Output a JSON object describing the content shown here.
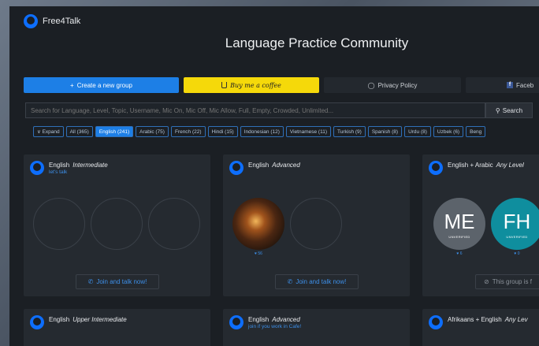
{
  "header": {
    "logo_text": "Free4Talk",
    "title": "Language Practice Community"
  },
  "topbar": {
    "create_label": "Create a new group",
    "coffee_label": "Buy me a coffee",
    "privacy_label": "Privacy Policy",
    "facebook_label": "Faceb"
  },
  "search": {
    "placeholder": "Search for Language, Level, Topic, Username, Mic On, Mic Off, Mic Allow, Full, Empty, Crowded, Unlimited...",
    "button_label": "Search"
  },
  "filters": [
    {
      "label": "∨ Expand"
    },
    {
      "label": "All (365)"
    },
    {
      "label": "English (241)",
      "active": true
    },
    {
      "label": "Arabic (75)"
    },
    {
      "label": "French (22)"
    },
    {
      "label": "Hindi (15)"
    },
    {
      "label": "Indonesian (12)"
    },
    {
      "label": "Vietnamese (11)"
    },
    {
      "label": "Turkish (9)"
    },
    {
      "label": "Spanish (8)"
    },
    {
      "label": "Urdu (8)"
    },
    {
      "label": "Uzbek (6)"
    },
    {
      "label": "Beng"
    }
  ],
  "cards": [
    {
      "language": "English",
      "level": "Intermediate",
      "topic": "let's talk",
      "join_label": "Join and talk now!"
    },
    {
      "language": "English",
      "level": "Advanced",
      "topic": "",
      "join_label": "Join and talk now!",
      "likes": "♥ 56"
    },
    {
      "language": "English + Arabic",
      "level": "Any Level",
      "topic": "",
      "join_label": "This group is f",
      "members": [
        {
          "initials": "ME",
          "badge": "UNVERIFIED",
          "likes": "♥ 6"
        },
        {
          "initials": "FH",
          "badge": "UNVERIFIED",
          "likes": "♥ 0"
        }
      ]
    },
    {
      "language": "English",
      "level": "Upper Intermediate",
      "topic": ""
    },
    {
      "language": "English",
      "level": "Advanced",
      "topic": "join if you work in Cafe!"
    },
    {
      "language": "Afrikaans + English",
      "level": "Any Lev",
      "topic": ""
    }
  ],
  "colors": {
    "accent": "#1d7fe6",
    "coffee": "#f5d90a",
    "background": "#1b1f24",
    "card": "#252a30",
    "link": "#3d8fe8"
  },
  "icons": {
    "logo": "free4talk-logo-icon",
    "plus": "plus-icon",
    "coffee": "coffee-cup-icon",
    "shield": "shield-icon",
    "facebook": "facebook-icon",
    "search": "search-icon",
    "phone": "phone-icon",
    "block": "block-icon"
  }
}
